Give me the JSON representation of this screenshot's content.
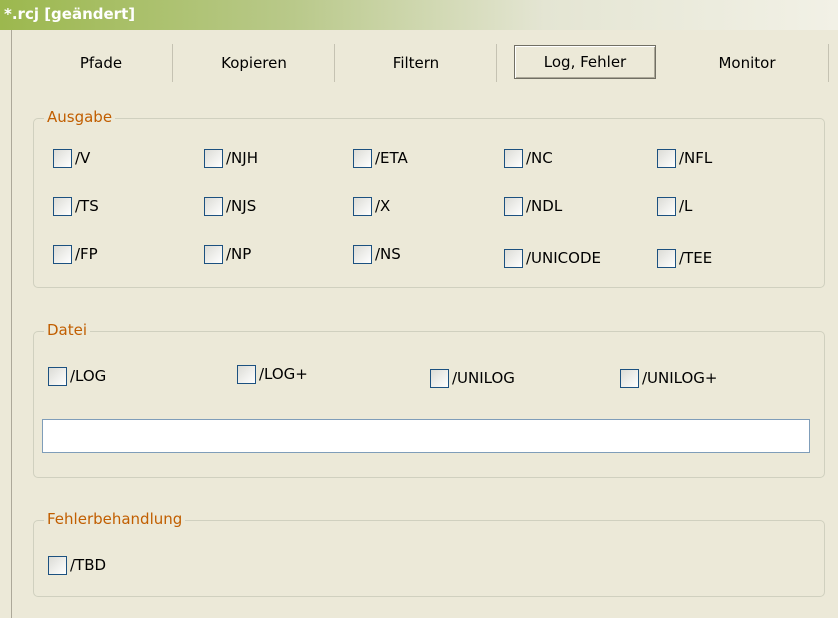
{
  "window": {
    "title": "*.rcj [geändert]"
  },
  "tabs": [
    {
      "label": "Pfade"
    },
    {
      "label": "Kopieren"
    },
    {
      "label": "Filtern"
    },
    {
      "label": "Log, Fehler",
      "active": true
    },
    {
      "label": "Monitor"
    }
  ],
  "ausgabe": {
    "title": "Ausgabe",
    "options": [
      "/V",
      "/NJH",
      "/ETA",
      "/NC",
      "/NFL",
      "/TS",
      "/NJS",
      "/X",
      "/NDL",
      "/L",
      "/FP",
      "/NP",
      "/NS",
      "/UNICODE",
      "/TEE"
    ]
  },
  "datei": {
    "title": "Datei",
    "options": [
      "/LOG",
      "/LOG+",
      "/UNILOG",
      "/UNILOG+"
    ],
    "path_value": ""
  },
  "fehler": {
    "title": "Fehlerbehandlung",
    "options": [
      "/TBD"
    ]
  },
  "colors": {
    "group_title": "#C15E00",
    "checkbox_border": "#1C5180",
    "window_bg": "#ECE9D8"
  }
}
